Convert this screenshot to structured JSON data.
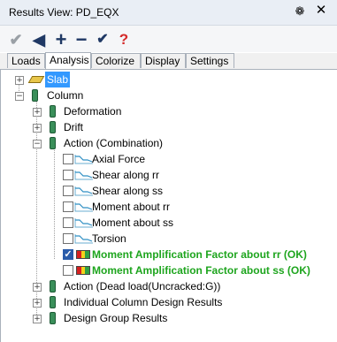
{
  "window": {
    "title": "Results View: PD_EQX",
    "pin_glyph": "❁",
    "close_glyph": "✕"
  },
  "toolbar": {
    "check_glyph": "✔",
    "back_glyph": "◀",
    "plus_glyph": "+",
    "minus_glyph": "−",
    "checkall_glyph": "✔",
    "help_glyph": "?"
  },
  "tabs": [
    "Loads",
    "Analysis",
    "Colorize",
    "Display",
    "Settings"
  ],
  "tree": {
    "slab": "Slab",
    "column": "Column",
    "deformation": "Deformation",
    "drift": "Drift",
    "action_combination": "Action (Combination)",
    "axial_force": "Axial Force",
    "shear_rr": "Shear along rr",
    "shear_ss": "Shear along ss",
    "moment_rr": "Moment about rr",
    "moment_ss": "Moment about ss",
    "torsion": "Torsion",
    "maf_rr": "Moment Amplification Factor about rr (OK)",
    "maf_ss": "Moment Amplification Factor about ss (OK)",
    "action_dead": "Action (Dead load(Uncracked:G))",
    "individual": "Individual Column Design Results",
    "design_group": "Design Group Results"
  },
  "glyphs": {
    "expand": "+",
    "collapse": "−",
    "check": "✓"
  },
  "colors": {
    "pass_green": "#1ea51e",
    "selection": "#3399ff",
    "checkbox_blue": "#2a5caa"
  }
}
